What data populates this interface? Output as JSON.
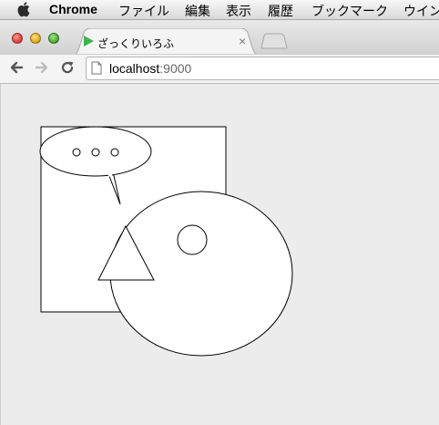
{
  "menubar": {
    "app_name": "Chrome",
    "items": [
      "ファイル",
      "編集",
      "表示",
      "履歴",
      "ブックマーク",
      "ウイン"
    ]
  },
  "tab": {
    "title": "ざっくりいろふ",
    "close_glyph": "×",
    "favicon": "green-play-triangle-icon"
  },
  "toolbar": {
    "back_icon": "back-arrow-icon",
    "forward_icon": "forward-arrow-icon",
    "reload_icon": "reload-icon",
    "url_host": "localhost",
    "url_port": ":9000"
  },
  "drawing": {
    "shapes": [
      "rectangle",
      "speech-bubble",
      "large-circle",
      "small-circle",
      "triangle"
    ],
    "speech_bubble_dots": 3
  },
  "colors": {
    "stroke": "#000000",
    "fill": "#ffffff",
    "page_background": "#ececec",
    "favicon_green": "#3bb54a"
  }
}
